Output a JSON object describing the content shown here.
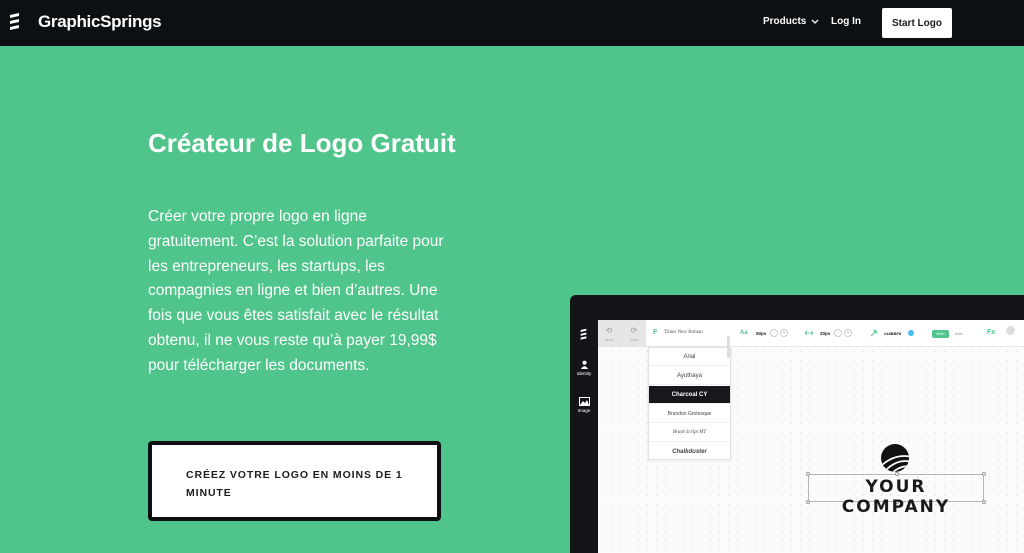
{
  "nav": {
    "brand": "GraphicSprings",
    "products": "Products",
    "login": "Log In",
    "start": "Start Logo"
  },
  "hero": {
    "title": "Créateur de Logo Gratuit",
    "description": "Créer votre propre logo en ligne gratuitement. C’est la solution parfaite pour les entrepreneurs, les startups, les compagnies en ligne et bien d’autres. Une fois que vous êtes satisfait avec le résultat obtenu, il ne vous reste qu’à payer 19,99$ pour télécharger les documents.",
    "cta": "CRÉEZ VOTRE LOGO EN MOINS DE 1 MINUTE"
  },
  "editor": {
    "sidebar": [
      "Identity",
      "Image"
    ],
    "toolbar": {
      "undo": "Undo",
      "redo": "Redo",
      "font_prefix": "F",
      "font": "Times New Roman",
      "size_prefix": "Aa",
      "size": "50px",
      "spacing": "20px",
      "color": "#44BBF8",
      "bold": "Bold",
      "italic": "Italic",
      "fx": "Fx"
    },
    "fonts": [
      "Arial",
      "Ayuthaya",
      "Charcoal CY",
      "Brandon Grotesque",
      "Brush Script MT",
      "Chalkduster"
    ],
    "selected_font": "Charcoal CY",
    "logo_text": "YOUR COMPANY"
  },
  "colors": {
    "background": "#4fc48b",
    "nav": "#0d1013",
    "accent": "#4fc48b"
  }
}
